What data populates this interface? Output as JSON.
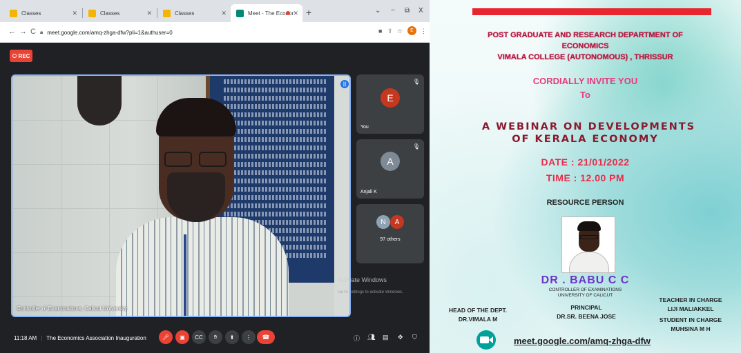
{
  "browser": {
    "tabs": [
      {
        "title": "Classes",
        "active": false
      },
      {
        "title": "Classes",
        "active": false
      },
      {
        "title": "Classes",
        "active": false
      },
      {
        "title": "Meet - The Economics Associ",
        "active": true
      }
    ],
    "new_tab": "+",
    "window_controls": {
      "dropdown": "⌄",
      "minimize": "−",
      "restore": "⧉",
      "close": "X"
    },
    "nav": {
      "back": "←",
      "forward": "→",
      "reload": "C"
    },
    "url": "meet.google.com/amq-zhga-dfw?pli=1&authuser=0",
    "profile_initial": "E"
  },
  "meet": {
    "rec_label": "REC",
    "main_speaker_label": "Controller of Examinations, Calicut University",
    "participants": [
      {
        "name": "You",
        "initial": "E",
        "color": "#c5381f"
      },
      {
        "name": "Anjali K",
        "initial": "A",
        "color": "#7e8a96"
      }
    ],
    "others": {
      "initials": [
        "N",
        "A"
      ],
      "colors": [
        "#8fa3b3",
        "#c5381f"
      ],
      "label": "97 others"
    },
    "time": "11:18 AM",
    "meeting_title": "The Economics Association Inauguration",
    "activate_windows": "Activate Windows",
    "activate_windows_sub": "Go to Settings to activate Windows."
  },
  "poster": {
    "dept_line1": "POST GRADUATE AND RESEARCH DEPARTMENT OF",
    "dept_line2": "ECONOMICS",
    "dept_line3": "VIMALA COLLEGE (AUTONOMOUS) , THRISSUR",
    "invite_line1": "CORDIALLY INVITE YOU",
    "invite_line2": "To",
    "webinar_line1": "A WEBINAR ON DEVELOPMENTS",
    "webinar_line2": "OF KERALA ECONOMY",
    "date": "DATE : 21/01/2022",
    "time": "TIME : 12.00 PM",
    "resource_heading": "RESOURCE PERSON",
    "speaker_name": "DR . BABU C C",
    "speaker_role1": "CONTROLLER OF EXAMINATIONS",
    "speaker_role2": "UNIVERSITY OF CALICUT",
    "hod_title": "HEAD OF THE DEPT.",
    "hod_name": "DR.VIMALA M",
    "principal_title": "PRINCIPAL",
    "principal_name": "DR.SR. BEENA JOSE",
    "teacher_title": "TEACHER IN CHARGE",
    "teacher_name": "LIJI MALIAKKEL",
    "student_title": "STUDENT IN CHARGE",
    "student_name": "MUHSINA M H",
    "meet_link": "meet.google.com/amq-zhga-dfw",
    "accent_red": "#e8262f"
  }
}
